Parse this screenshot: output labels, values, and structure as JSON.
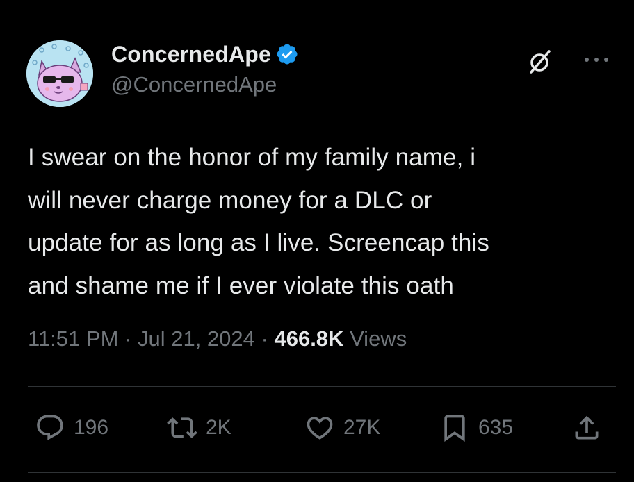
{
  "author": {
    "display_name": "ConcernedApe",
    "handle": "@ConcernedApe",
    "verified": true,
    "badge_color": "#1d9bf0"
  },
  "tweet": {
    "text": "I swear on the honor of my family name,  i\nwill never charge money for a DLC or\nupdate for as long as I live. Screencap this\nand shame me if I ever violate this oath"
  },
  "meta": {
    "time": "11:51 PM",
    "separator": "·",
    "date": "Jul 21, 2024",
    "views_count": "466.8K",
    "views_label": "Views"
  },
  "actions": {
    "replies": "196",
    "retweets": "2K",
    "likes": "27K",
    "bookmarks": "635"
  },
  "icons": {
    "grok": "grok-icon",
    "more": "more-icon",
    "reply": "reply-icon",
    "retweet": "retweet-icon",
    "like": "heart-icon",
    "bookmark": "bookmark-icon",
    "share": "share-icon"
  },
  "colors": {
    "background": "#000000",
    "text_primary": "#e7e9ea",
    "text_secondary": "#71767b",
    "divider": "#2f3336"
  }
}
